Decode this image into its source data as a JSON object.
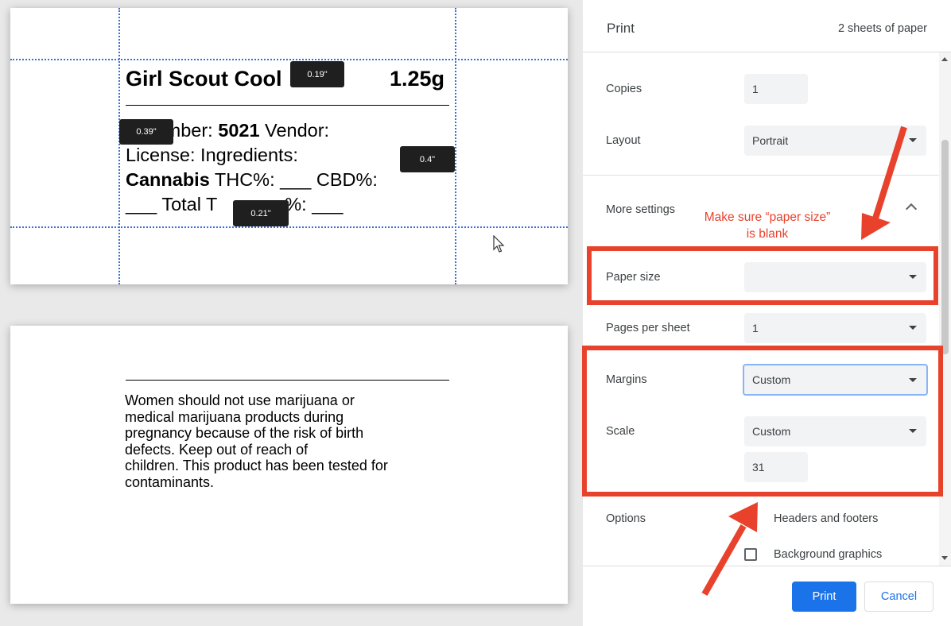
{
  "preview": {
    "label": {
      "title": "Girl Scout Cool",
      "weight": "1.25g",
      "line1_pre": "n Number: ",
      "line1_bold": "5021",
      "line1_post": " Vendor:",
      "line2": "License:  Ingredients:",
      "line3_bold": "Cannabis",
      "line3_post": " THC%: ___  CBD%:",
      "line4": "___  Total T",
      "line4_post": "es%: ___"
    },
    "margin_tooltips": {
      "top": "0.19\"",
      "left": "0.39\"",
      "right": "0.4\"",
      "bottom": "0.21\""
    },
    "warning_lines": [
      "Women should not use marijuana or",
      "medical marijuana products during",
      "pregnancy because of the risk of birth",
      "defects.  Keep out of reach of",
      "children.  This product has been tested for",
      "contaminants."
    ]
  },
  "panel": {
    "title": "Print",
    "sheets": "2 sheets of paper",
    "copies": {
      "label": "Copies",
      "value": "1"
    },
    "layout": {
      "label": "Layout",
      "value": "Portrait"
    },
    "more_settings": {
      "label": "More settings"
    },
    "paper_size": {
      "label": "Paper size",
      "value": ""
    },
    "pages_per_sheet": {
      "label": "Pages per sheet",
      "value": "1"
    },
    "margins": {
      "label": "Margins",
      "value": "Custom"
    },
    "scale": {
      "label": "Scale",
      "value": "Custom",
      "custom_value": "31"
    },
    "options": {
      "label": "Options",
      "items": [
        {
          "label": "Headers and footers"
        },
        {
          "label": "Background graphics",
          "checked": false
        }
      ]
    },
    "buttons": {
      "print": "Print",
      "cancel": "Cancel"
    }
  },
  "annotation": {
    "line1": "Make sure “paper size”",
    "line2": "is blank",
    "color": "#e8422c"
  }
}
